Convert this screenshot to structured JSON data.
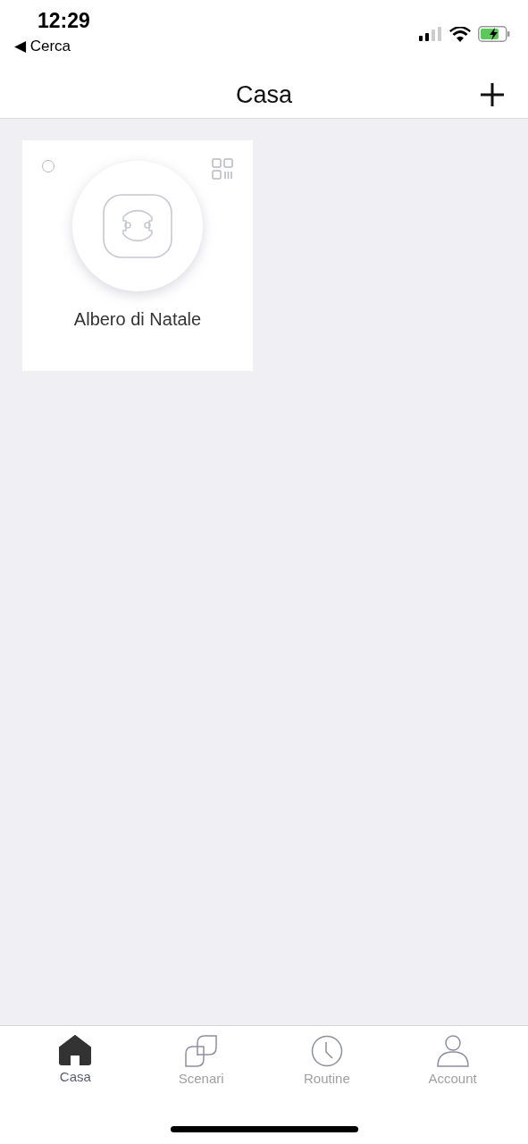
{
  "status_bar": {
    "time": "12:29",
    "back_link": "◀ Cerca"
  },
  "nav_bar": {
    "title": "Casa"
  },
  "devices": [
    {
      "name": "Albero di Natale",
      "selected": false
    }
  ],
  "tab_bar": [
    {
      "label": "Casa",
      "kind": "home",
      "selected": true
    },
    {
      "label": "Scenari",
      "kind": "scenes",
      "selected": false
    },
    {
      "label": "Routine",
      "kind": "clock",
      "selected": false
    },
    {
      "label": "Account",
      "kind": "person",
      "selected": false
    }
  ]
}
